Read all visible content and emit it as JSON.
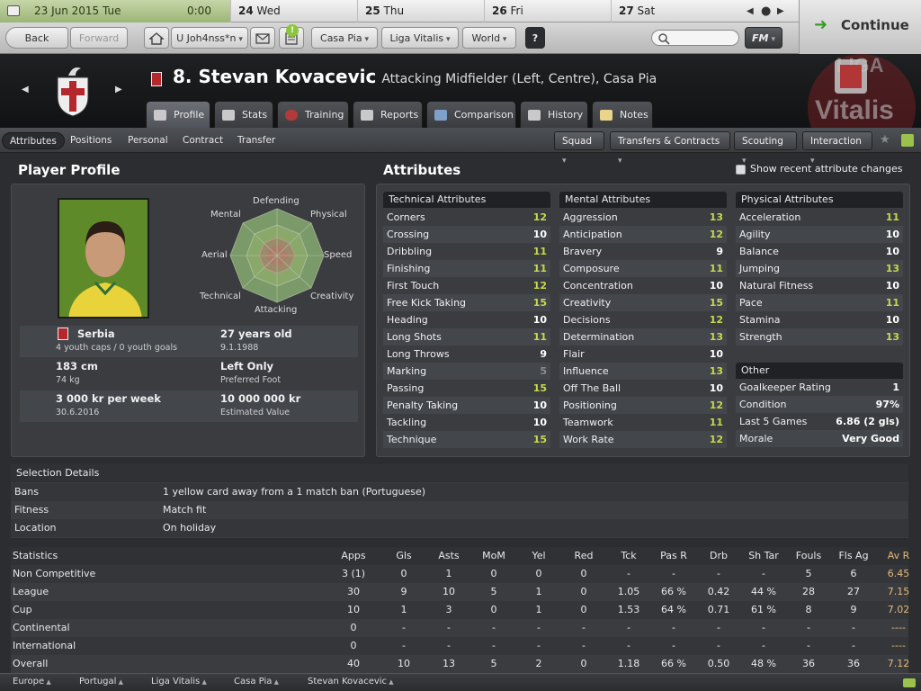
{
  "calendar": {
    "current_date": "23 Jun 2015",
    "current_day": "Tue",
    "time": "0:00",
    "days": [
      {
        "num": "24",
        "day": "Wed"
      },
      {
        "num": "25",
        "day": "Thu"
      },
      {
        "num": "26",
        "day": "Fri"
      },
      {
        "num": "27",
        "day": "Sat"
      }
    ]
  },
  "nav": {
    "back": "Back",
    "forward": "Forward",
    "user": "U Joh4nss*n",
    "club": "Casa Pia",
    "league": "Liga Vitalis",
    "world": "World",
    "help": "?",
    "fm": "FM",
    "continue": "Continue"
  },
  "player": {
    "number_name": "8. Stevan Kovacevic",
    "role": "Attacking Midfielder (Left, Centre), Casa Pia"
  },
  "tabs": [
    "Profile",
    "Stats",
    "Training",
    "Reports",
    "Comparison",
    "History",
    "Notes"
  ],
  "subtabs": [
    "Attributes",
    "Positions",
    "Personal",
    "Contract",
    "Transfer"
  ],
  "subbuttons": [
    "Squad",
    "Transfers & Contracts",
    "Scouting",
    "Interaction"
  ],
  "profile": {
    "title": "Player Profile",
    "nation": "Serbia",
    "caps": "4 youth caps / 0 youth goals",
    "age": "27 years old",
    "dob": "9.1.1988",
    "height": "183 cm",
    "weight": "74 kg",
    "foot": "Left Only",
    "foot_label": "Preferred Foot",
    "wage": "3 000 kr per week",
    "contract_end": "30.6.2016",
    "value": "10 000 000 kr",
    "value_label": "Estimated Value",
    "radar": [
      "Defending",
      "Physical",
      "Speed",
      "Creativity",
      "Attacking",
      "Technical",
      "Aerial",
      "Mental"
    ]
  },
  "attributes": {
    "title": "Attributes",
    "toggle": "Show recent attribute changes",
    "technical": {
      "header": "Technical Attributes",
      "items": [
        [
          "Corners",
          "12"
        ],
        [
          "Crossing",
          "10"
        ],
        [
          "Dribbling",
          "11"
        ],
        [
          "Finishing",
          "11"
        ],
        [
          "First Touch",
          "12"
        ],
        [
          "Free Kick Taking",
          "15"
        ],
        [
          "Heading",
          "10"
        ],
        [
          "Long Shots",
          "11"
        ],
        [
          "Long Throws",
          "9"
        ],
        [
          "Marking",
          "5"
        ],
        [
          "Passing",
          "15"
        ],
        [
          "Penalty Taking",
          "10"
        ],
        [
          "Tackling",
          "10"
        ],
        [
          "Technique",
          "15"
        ]
      ]
    },
    "mental": {
      "header": "Mental Attributes",
      "items": [
        [
          "Aggression",
          "13"
        ],
        [
          "Anticipation",
          "12"
        ],
        [
          "Bravery",
          "9"
        ],
        [
          "Composure",
          "11"
        ],
        [
          "Concentration",
          "10"
        ],
        [
          "Creativity",
          "15"
        ],
        [
          "Decisions",
          "12"
        ],
        [
          "Determination",
          "13"
        ],
        [
          "Flair",
          "10"
        ],
        [
          "Influence",
          "13"
        ],
        [
          "Off The Ball",
          "10"
        ],
        [
          "Positioning",
          "12"
        ],
        [
          "Teamwork",
          "11"
        ],
        [
          "Work Rate",
          "12"
        ]
      ]
    },
    "physical": {
      "header": "Physical Attributes",
      "items": [
        [
          "Acceleration",
          "11"
        ],
        [
          "Agility",
          "10"
        ],
        [
          "Balance",
          "10"
        ],
        [
          "Jumping",
          "13"
        ],
        [
          "Natural Fitness",
          "10"
        ],
        [
          "Pace",
          "11"
        ],
        [
          "Stamina",
          "10"
        ],
        [
          "Strength",
          "13"
        ]
      ]
    },
    "other": {
      "header": "Other",
      "items": [
        [
          "Goalkeeper Rating",
          "1"
        ],
        [
          "Condition",
          "97%"
        ],
        [
          "Last 5 Games",
          "6.86 (2 gls)"
        ],
        [
          "Morale",
          "Very Good"
        ]
      ]
    }
  },
  "selection": {
    "title": "Selection Details",
    "rows": [
      [
        "Bans",
        "1 yellow card away from a 1 match ban (Portuguese)"
      ],
      [
        "Fitness",
        "Match fit"
      ],
      [
        "Location",
        "On holiday"
      ]
    ]
  },
  "stats": {
    "headers": [
      "Statistics",
      "Apps",
      "Gls",
      "Asts",
      "MoM",
      "Yel",
      "Red",
      "Tck",
      "Pas R",
      "Drb",
      "Sh Tar",
      "Fouls",
      "Fls Ag",
      "Av R"
    ],
    "rows": [
      [
        "Non Competitive",
        "3 (1)",
        "0",
        "1",
        "0",
        "0",
        "0",
        "-",
        "-",
        "-",
        "-",
        "5",
        "6",
        "6.45"
      ],
      [
        "League",
        "30",
        "9",
        "10",
        "5",
        "1",
        "0",
        "1.05",
        "66 %",
        "0.42",
        "44 %",
        "28",
        "27",
        "7.15"
      ],
      [
        "Cup",
        "10",
        "1",
        "3",
        "0",
        "1",
        "0",
        "1.53",
        "64 %",
        "0.71",
        "61 %",
        "8",
        "9",
        "7.02"
      ],
      [
        "Continental",
        "0",
        "-",
        "-",
        "-",
        "-",
        "-",
        "-",
        "-",
        "-",
        "-",
        "-",
        "-",
        "----"
      ],
      [
        "International",
        "0",
        "-",
        "-",
        "-",
        "-",
        "-",
        "-",
        "-",
        "-",
        "-",
        "-",
        "-",
        "----"
      ],
      [
        "Overall",
        "40",
        "10",
        "13",
        "5",
        "2",
        "0",
        "1.18",
        "66 %",
        "0.50",
        "48 %",
        "36",
        "36",
        "7.12"
      ]
    ]
  },
  "breadcrumbs": [
    "Europe",
    "Portugal",
    "Liga Vitalis",
    "Casa Pia",
    "Stevan Kovacevic"
  ],
  "colors": {
    "highlight": "#c8d84a",
    "average_rating": "#e4b97b",
    "calendar_current": "#9db577"
  }
}
